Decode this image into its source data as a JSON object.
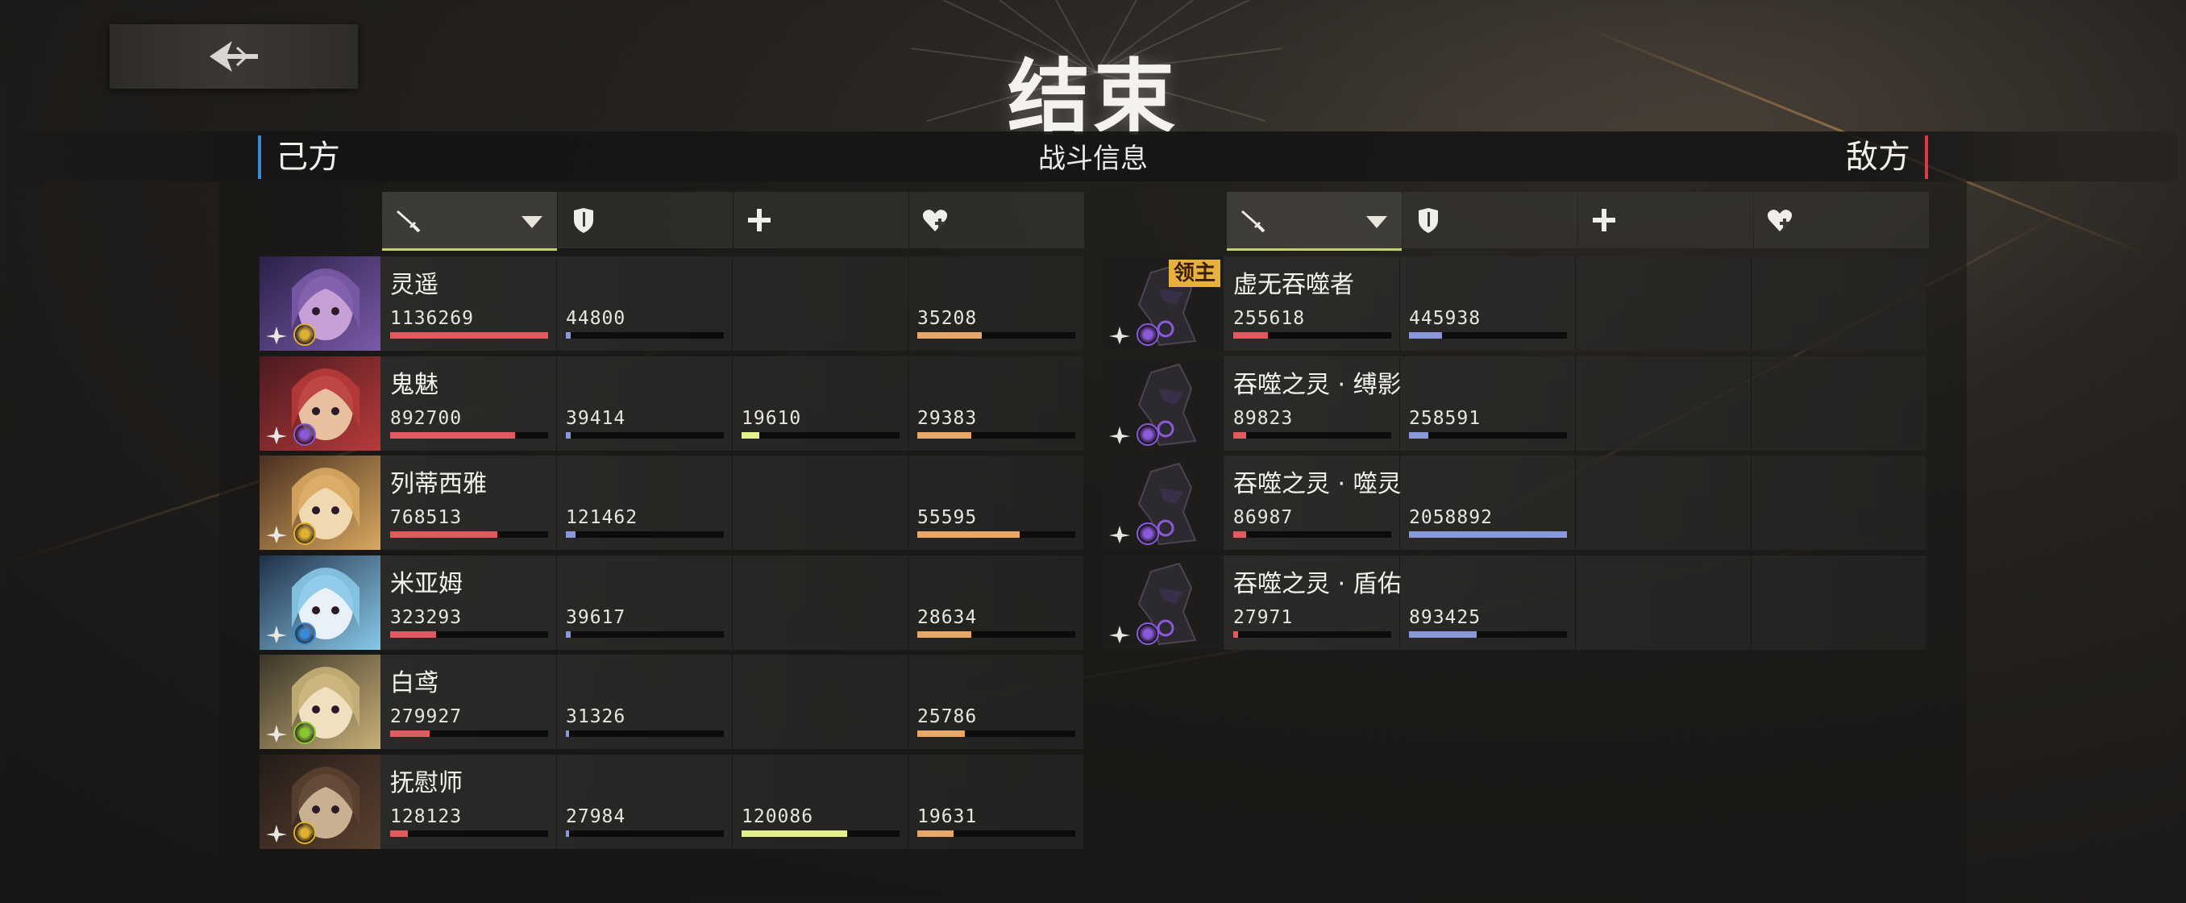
{
  "header": {
    "title": "结束",
    "info_title": "战斗信息",
    "left_side": "己方",
    "right_side": "敌方",
    "back_icon": "back-arrow-icon"
  },
  "columns": [
    {
      "icon": "sword-icon",
      "meaning": "damage",
      "sorted": true
    },
    {
      "icon": "shield-icon",
      "meaning": "damage-taken"
    },
    {
      "icon": "plus-icon",
      "meaning": "healing"
    },
    {
      "icon": "heart-plus-icon",
      "meaning": "healing-received"
    }
  ],
  "colors": {
    "damage": "#e05a60",
    "taken": "#8898d8",
    "heal": "#e6f08a",
    "received": "#e8a868",
    "accent_left": "#3a8ad8",
    "accent_right": "#d83a4a",
    "sort_underline": "#c7cf68"
  },
  "allies": [
    {
      "name": "灵遥",
      "damage": "1136269",
      "taken": "44800",
      "heal": "",
      "received": "35208",
      "fills": {
        "damage": 1.0,
        "taken": 0.03,
        "heal": 0,
        "received": 0.41
      },
      "element_color": "#e0b030",
      "portrait": [
        "#2a2048",
        "#7a5aa8",
        "#c8a0d8"
      ]
    },
    {
      "name": "鬼魅",
      "damage": "892700",
      "taken": "39414",
      "heal": "19610",
      "received": "29383",
      "fills": {
        "damage": 0.79,
        "taken": 0.03,
        "heal": 0.11,
        "received": 0.34
      },
      "element_color": "#8a5ad8",
      "portrait": [
        "#4a1a20",
        "#b83a3a",
        "#e8c0a0"
      ]
    },
    {
      "name": "列蒂西雅",
      "damage": "768513",
      "taken": "121462",
      "heal": "",
      "received": "55595",
      "fills": {
        "damage": 0.68,
        "taken": 0.06,
        "heal": 0,
        "received": 0.65
      },
      "element_color": "#e0b030",
      "portrait": [
        "#4a3020",
        "#d8a860",
        "#f0d8b0"
      ]
    },
    {
      "name": "米亚姆",
      "damage": "323293",
      "taken": "39617",
      "heal": "",
      "received": "28634",
      "fills": {
        "damage": 0.29,
        "taken": 0.03,
        "heal": 0,
        "received": 0.34
      },
      "element_color": "#3a8ad8",
      "portrait": [
        "#203048",
        "#88c8e8",
        "#e8f0f8"
      ]
    },
    {
      "name": "白鸢",
      "damage": "279927",
      "taken": "31326",
      "heal": "",
      "received": "25786",
      "fills": {
        "damage": 0.25,
        "taken": 0.02,
        "heal": 0,
        "received": 0.3
      },
      "element_color": "#8ac830",
      "portrait": [
        "#3a3528",
        "#c8b078",
        "#f0e0c0"
      ]
    },
    {
      "name": "抚慰师",
      "damage": "128123",
      "taken": "27984",
      "heal": "120086",
      "received": "19631",
      "fills": {
        "damage": 0.11,
        "taken": 0.02,
        "heal": 0.67,
        "received": 0.23
      },
      "element_color": "#e0b030",
      "portrait": [
        "#241c18",
        "#5a4030",
        "#c8b090"
      ]
    }
  ],
  "enemies": [
    {
      "name": "虚无吞噬者",
      "badge": "领主",
      "damage": "255618",
      "taken": "445938",
      "heal": "",
      "received": "",
      "fills": {
        "damage": 0.22,
        "taken": 0.21,
        "heal": 0,
        "received": 0
      },
      "element_color": "#8a5ad8"
    },
    {
      "name": "吞噬之灵 · 缚影",
      "badge": "",
      "damage": "89823",
      "taken": "258591",
      "heal": "",
      "received": "",
      "fills": {
        "damage": 0.08,
        "taken": 0.12,
        "heal": 0,
        "received": 0
      },
      "element_color": "#8a5ad8"
    },
    {
      "name": "吞噬之灵 · 噬灵",
      "badge": "",
      "damage": "86987",
      "taken": "2058892",
      "heal": "",
      "received": "",
      "fills": {
        "damage": 0.08,
        "taken": 1.0,
        "heal": 0,
        "received": 0
      },
      "element_color": "#8a5ad8"
    },
    {
      "name": "吞噬之灵 · 盾佑",
      "badge": "",
      "damage": "27971",
      "taken": "893425",
      "heal": "",
      "received": "",
      "fills": {
        "damage": 0.03,
        "taken": 0.43,
        "heal": 0,
        "received": 0
      },
      "element_color": "#8a5ad8"
    }
  ]
}
